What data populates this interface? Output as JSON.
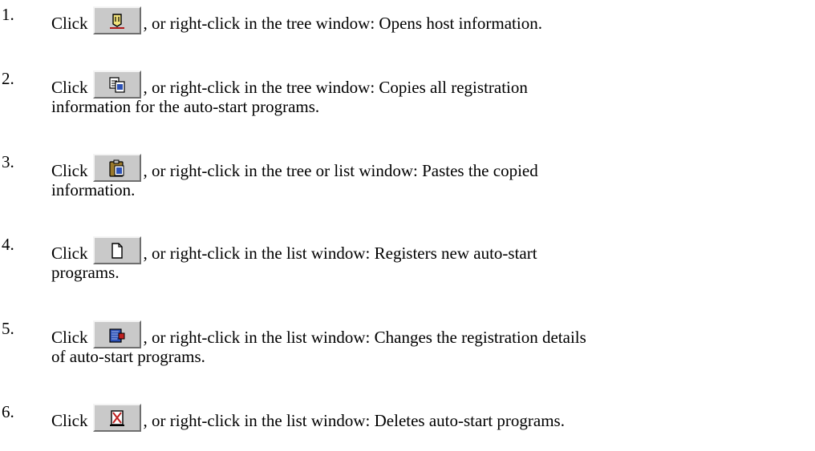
{
  "items": [
    {
      "num": "1.",
      "click": "Click",
      "rest": ", or right-click in the tree window: Opens host information.",
      "cont": "",
      "icon": "host-info-icon"
    },
    {
      "num": "2.",
      "click": "Click",
      "rest": ", or right-click in the tree window: Copies all registration",
      "cont": "information for the auto-start programs.",
      "icon": "copy-icon"
    },
    {
      "num": "3.",
      "click": "Click",
      "rest": ", or right-click in the tree or list window: Pastes the copied",
      "cont": "information.",
      "icon": "paste-icon"
    },
    {
      "num": "4.",
      "click": "Click",
      "rest": ", or right-click in the list window: Registers new auto-start",
      "cont": "programs.",
      "icon": "new-document-icon"
    },
    {
      "num": "5.",
      "click": "Click",
      "rest": ", or right-click in the list window: Changes the registration details",
      "cont": "of auto-start programs.",
      "icon": "edit-details-icon"
    },
    {
      "num": "6.",
      "click": "Click",
      "rest": ", or right-click in the list window: Deletes auto-start programs.",
      "cont": "",
      "icon": "delete-icon"
    }
  ]
}
